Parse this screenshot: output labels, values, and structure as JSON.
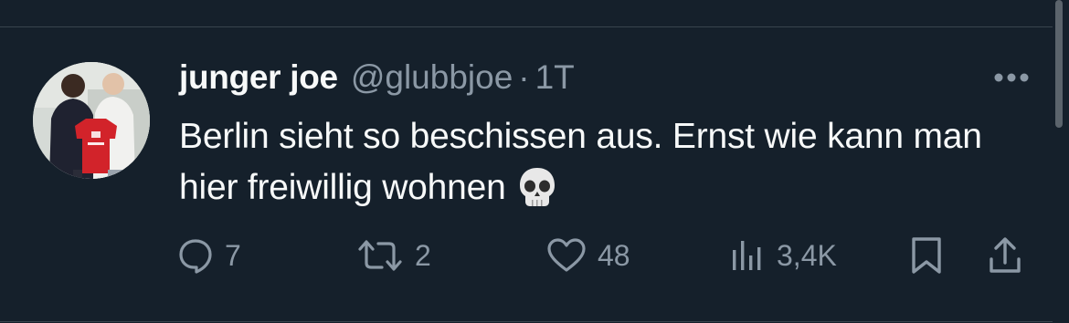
{
  "tweet": {
    "display_name": "junger joe",
    "handle": "@glubbjoe",
    "separator": "·",
    "time": "1T",
    "text": "Berlin sieht so beschissen aus. Ernst wie kann man hier freiwillig wohnen",
    "emoji": "skull-emoji"
  },
  "actions": {
    "reply": {
      "icon": "reply-icon",
      "count": "7"
    },
    "retweet": {
      "icon": "retweet-icon",
      "count": "2"
    },
    "like": {
      "icon": "heart-icon",
      "count": "48"
    },
    "views": {
      "icon": "views-icon",
      "count": "3,4K"
    },
    "bookmark": {
      "icon": "bookmark-icon"
    },
    "share": {
      "icon": "share-icon"
    }
  },
  "colors": {
    "background": "#15202b",
    "text_primary": "#f7f9f9",
    "text_secondary": "#8b98a5",
    "divider": "#38444d"
  }
}
